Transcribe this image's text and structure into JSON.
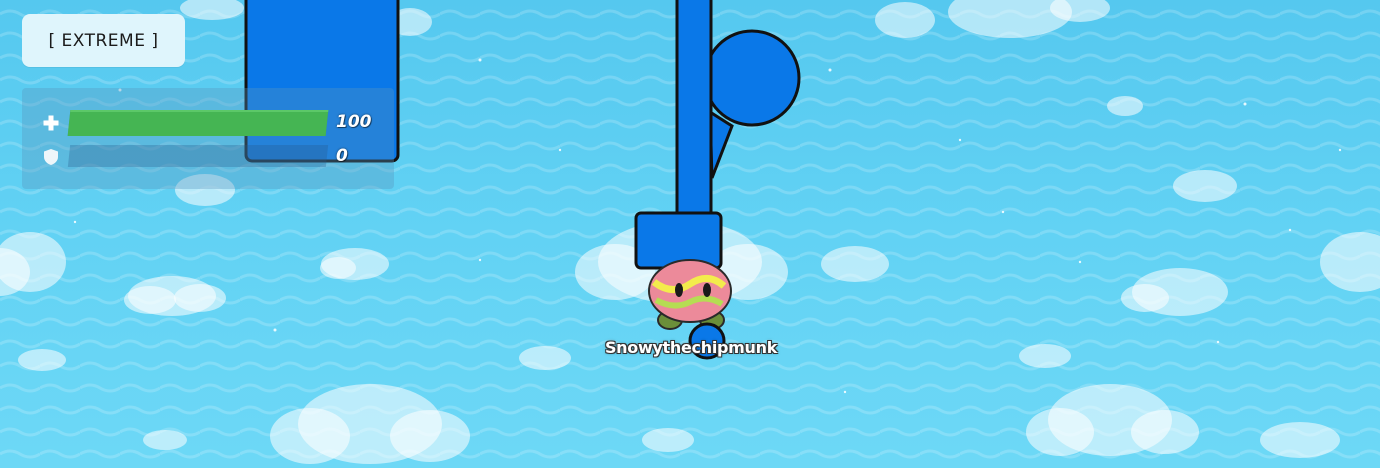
{
  "game_mode": {
    "label": "[ EXTREME ]"
  },
  "stats": {
    "health": {
      "icon": "health-cross-icon",
      "value": "100",
      "fraction": 1.0,
      "color": "#45b553"
    },
    "shield": {
      "icon": "shield-icon",
      "value": "0",
      "fraction": 0.0
    }
  },
  "player": {
    "name": "Snowythechipmunk"
  },
  "colors": {
    "sky": "#5ccdf2",
    "structure_blue": "#0a78e8",
    "outline": "#111111"
  }
}
